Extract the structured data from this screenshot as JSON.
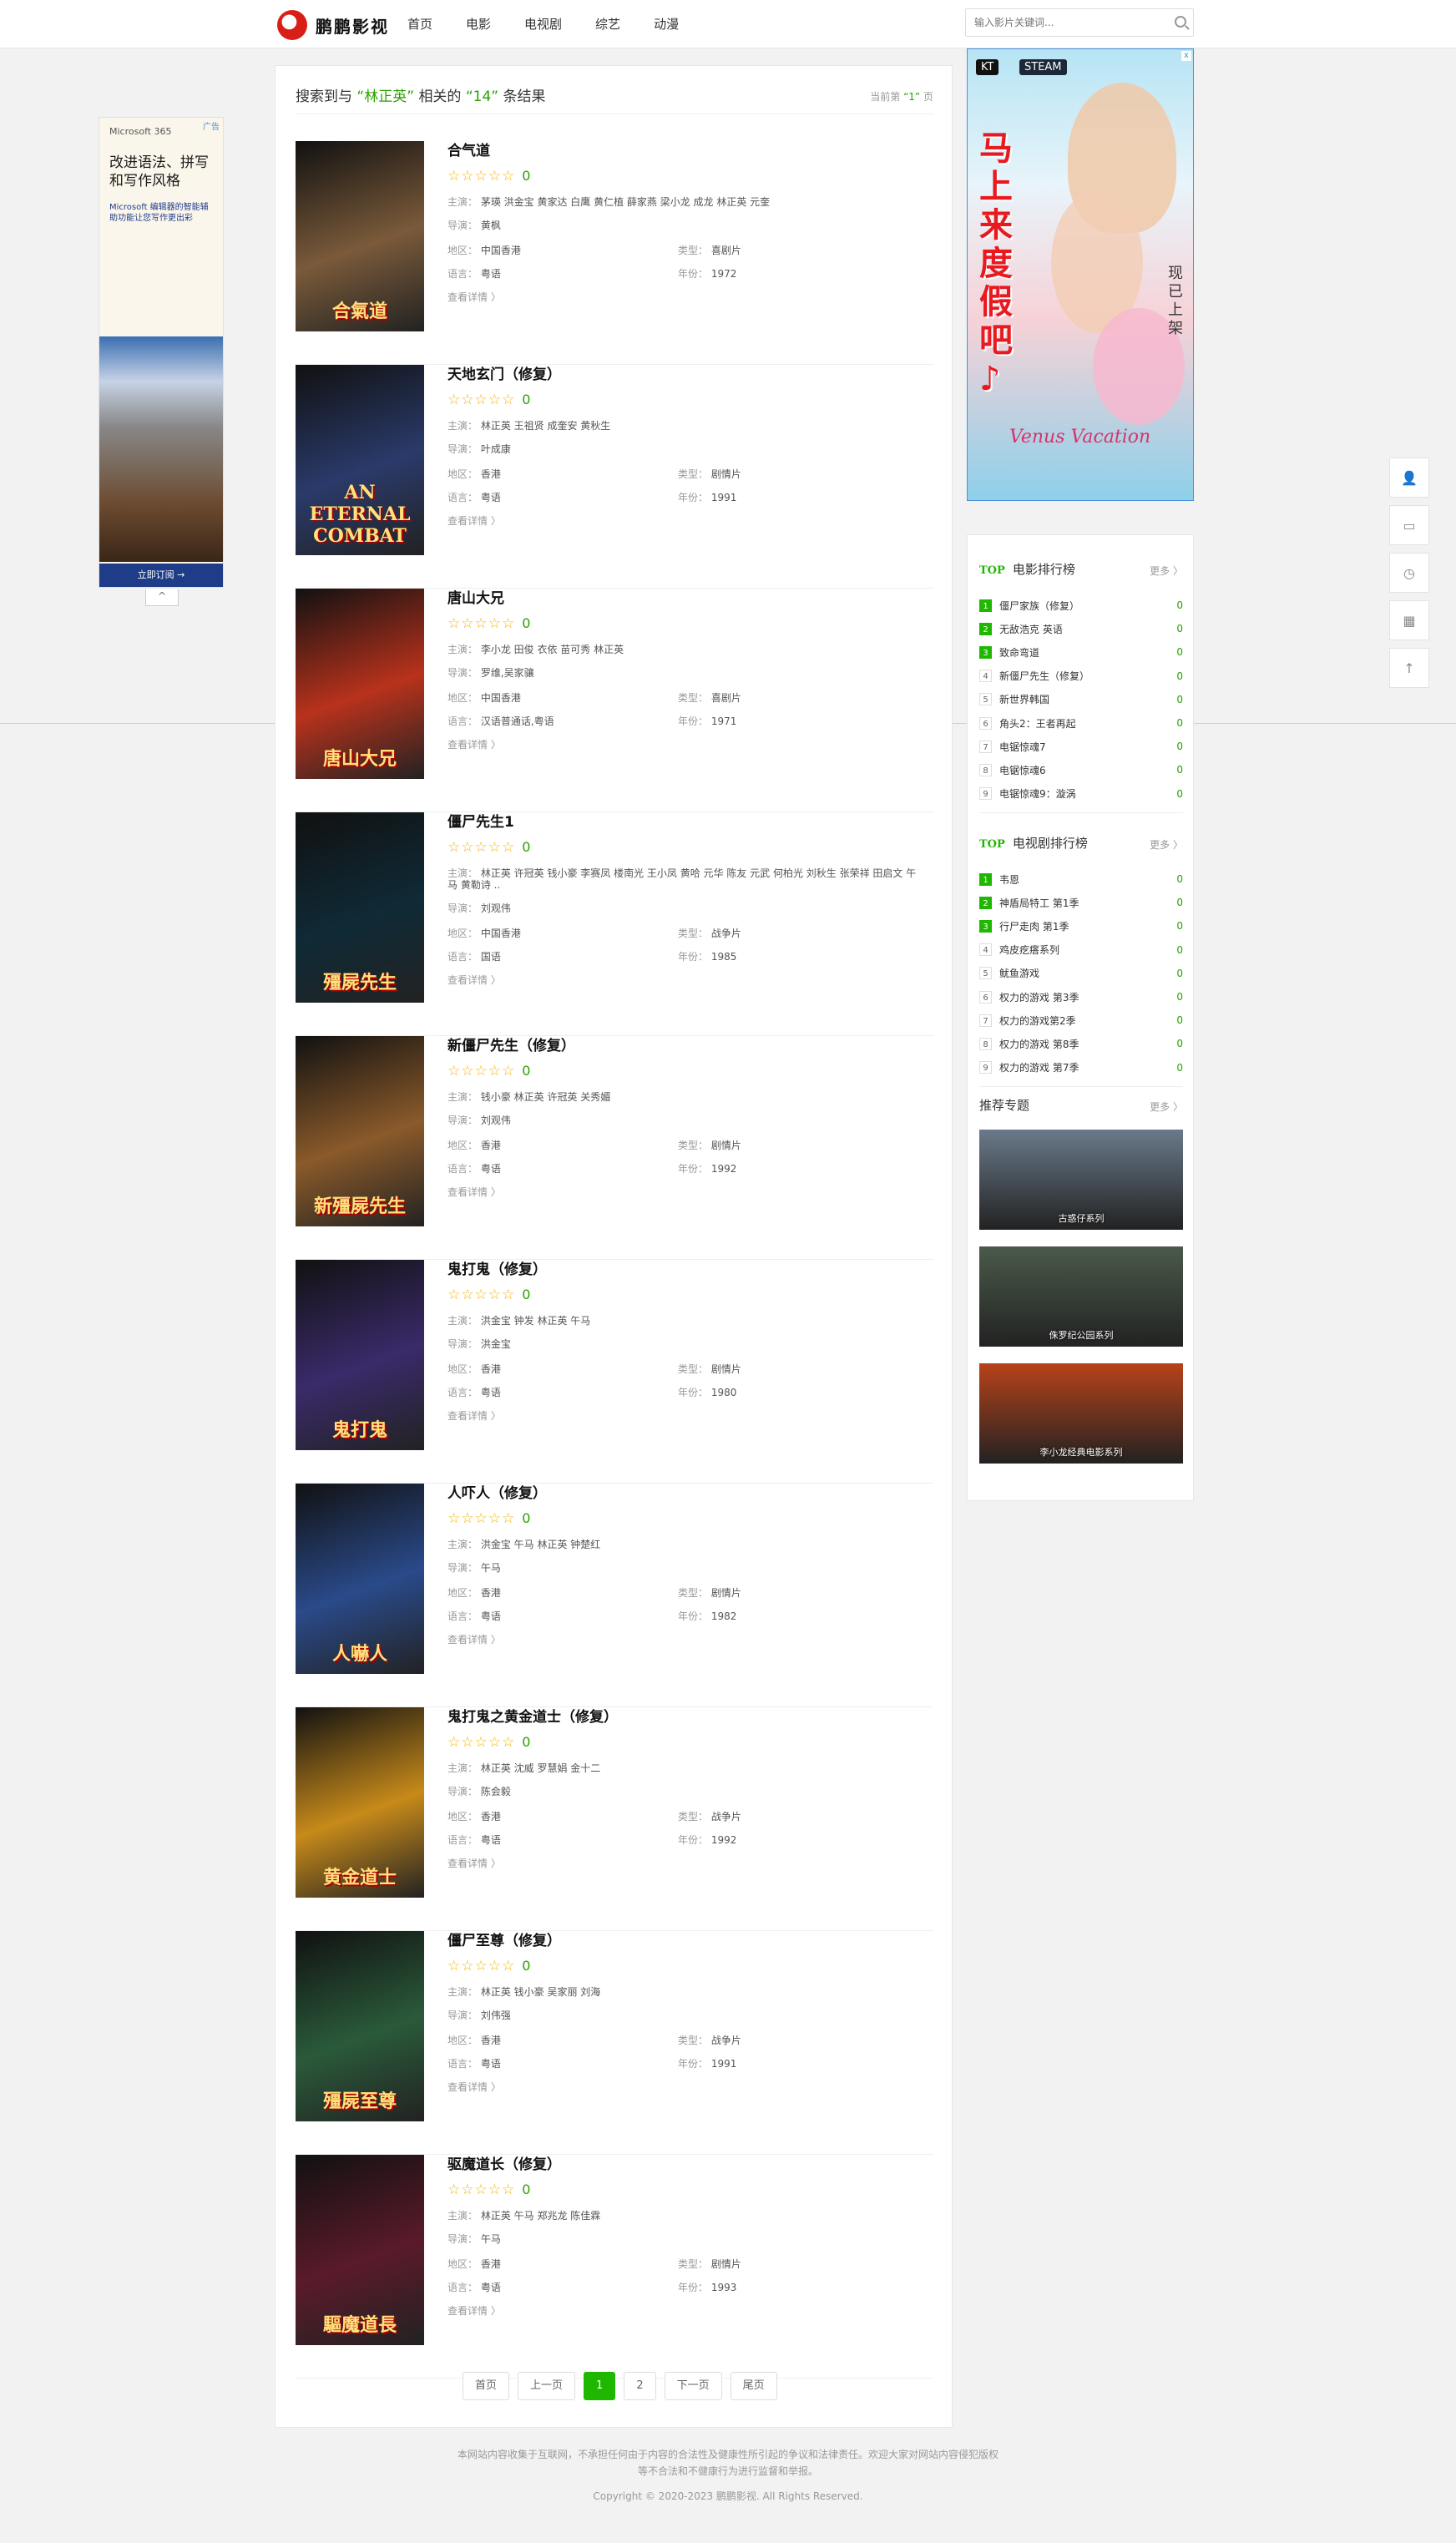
{
  "site": {
    "logo_text": "鹏鹏影视",
    "nav": [
      "首页",
      "电影",
      "电视剧",
      "综艺",
      "动漫"
    ],
    "search_placeholder": "输入影片关键词..."
  },
  "left_ad": {
    "brand": "Microsoft 365",
    "ad_mark": "广告",
    "headline": "改进语法、拼写和写作风格",
    "sub": "Microsoft 编辑器的智能辅助功能让您写作更出彩",
    "cta": "立即订阅 →",
    "close": "^"
  },
  "results": {
    "prefix": "搜索到与",
    "keyword": "“林正英”",
    "middle": "相关的",
    "count": "“14”",
    "suffix": "条结果",
    "page_prefix": "当前第",
    "page_num": "“1”",
    "page_suffix": "页",
    "labels": {
      "actors": "主演：",
      "director": "导演：",
      "region": "地区：",
      "type": "类型：",
      "lang": "语言：",
      "year": "年份：",
      "detail": "查看详情 〉"
    },
    "stars": "☆☆☆☆☆",
    "items": [
      {
        "title": "合气道",
        "score": "0",
        "actors": "茅瑛 洪金宝 黄家达 白鹰 黄仁植 薛家燕 梁小龙 成龙 林正英 元奎",
        "director": "黄枫",
        "region": "中国香港",
        "type": "喜剧片",
        "lang": "粤语",
        "year": "1972",
        "poster_text": "合氣道",
        "poster_color": "#7a5a3a"
      },
      {
        "title": "天地玄门（修复）",
        "score": "0",
        "actors": "林正英 王祖贤 成奎安 黄秋生",
        "director": "叶成康",
        "region": "香港",
        "type": "剧情片",
        "lang": "粤语",
        "year": "1991",
        "poster_text": "AN ETERNAL COMBAT",
        "poster_color": "#2a3a6a"
      },
      {
        "title": "唐山大兄",
        "score": "0",
        "actors": "李小龙 田俊 衣依 苗可秀 林正英",
        "director": "罗维,吴家骧",
        "region": "中国香港",
        "type": "喜剧片",
        "lang": "汉语普通话,粤语",
        "year": "1971",
        "poster_text": "唐山大兄",
        "poster_color": "#b8321c"
      },
      {
        "title": "僵尸先生1",
        "score": "0",
        "actors": "林正英 许冠英 钱小豪 李赛凤 楼南光 王小凤 黄哈 元华 陈友 元武 何柏光 刘秋生 张荣祥 田启文 午马 黄勒诗 ..",
        "director": "刘观伟",
        "region": "中国香港",
        "type": "战争片",
        "lang": "国语",
        "year": "1985",
        "poster_text": "殭屍先生",
        "poster_color": "#0f2a36"
      },
      {
        "title": "新僵尸先生（修复）",
        "score": "0",
        "actors": "钱小豪 林正英 许冠英 关秀媚",
        "director": "刘观伟",
        "region": "香港",
        "type": "剧情片",
        "lang": "粤语",
        "year": "1992",
        "poster_text": "新殭屍先生",
        "poster_color": "#8a5a2a"
      },
      {
        "title": "鬼打鬼（修复）",
        "score": "0",
        "actors": "洪金宝 钟发 林正英 午马",
        "director": "洪金宝",
        "region": "香港",
        "type": "剧情片",
        "lang": "粤语",
        "year": "1980",
        "poster_text": "鬼打鬼",
        "poster_color": "#3a2a6a"
      },
      {
        "title": "人吓人（修复）",
        "score": "0",
        "actors": "洪金宝 午马 林正英 钟楚红",
        "director": "午马",
        "region": "香港",
        "type": "剧情片",
        "lang": "粤语",
        "year": "1982",
        "poster_text": "人嚇人",
        "poster_color": "#2a4a8a"
      },
      {
        "title": "鬼打鬼之黄金道士（修复）",
        "score": "0",
        "actors": "林正英 沈威 罗慧娟 金十二",
        "director": "陈会毅",
        "region": "香港",
        "type": "战争片",
        "lang": "粤语",
        "year": "1992",
        "poster_text": "黄金道士",
        "poster_color": "#c78a1a"
      },
      {
        "title": "僵尸至尊（修复）",
        "score": "0",
        "actors": "林正英 钱小豪 吴家丽 刘海",
        "director": "刘伟强",
        "region": "香港",
        "type": "战争片",
        "lang": "粤语",
        "year": "1991",
        "poster_text": "殭屍至尊",
        "poster_color": "#2a5a3a"
      },
      {
        "title": "驱魔道长（修复）",
        "score": "0",
        "actors": "林正英 午马 郑兆龙 陈佳霖",
        "director": "午马",
        "region": "香港",
        "type": "剧情片",
        "lang": "粤语",
        "year": "1993",
        "poster_text": "驅魔道長",
        "poster_color": "#5a1a2a"
      }
    ]
  },
  "pager": {
    "first": "首页",
    "prev": "上一页",
    "pages": [
      "1",
      "2"
    ],
    "next": "下一页",
    "last": "尾页"
  },
  "right_ad": {
    "brand": "KT",
    "steam": "STEAM",
    "headline": "马上来度假吧♪",
    "side": "现已上架",
    "title": "Venus Vacation",
    "close": "x"
  },
  "movie_rank": {
    "top": "TOP",
    "title": "电影排行榜",
    "more": "更多 〉",
    "items": [
      {
        "n": "1",
        "name": "僵尸家族（修复）",
        "v": "0"
      },
      {
        "n": "2",
        "name": "无敌浩克 英语",
        "v": "0"
      },
      {
        "n": "3",
        "name": "致命弯道",
        "v": "0"
      },
      {
        "n": "4",
        "name": "新僵尸先生（修复）",
        "v": "0"
      },
      {
        "n": "5",
        "name": "新世界韩国",
        "v": "0"
      },
      {
        "n": "6",
        "name": "角头2：王者再起",
        "v": "0"
      },
      {
        "n": "7",
        "name": "电锯惊魂7",
        "v": "0"
      },
      {
        "n": "8",
        "name": "电锯惊魂6",
        "v": "0"
      },
      {
        "n": "9",
        "name": "电锯惊魂9：漩涡",
        "v": "0"
      }
    ]
  },
  "tv_rank": {
    "top": "TOP",
    "title": "电视剧排行榜",
    "more": "更多 〉",
    "items": [
      {
        "n": "1",
        "name": "韦恩",
        "v": "0"
      },
      {
        "n": "2",
        "name": "神盾局特工 第1季",
        "v": "0"
      },
      {
        "n": "3",
        "name": "行尸走肉 第1季",
        "v": "0"
      },
      {
        "n": "4",
        "name": "鸡皮疙瘩系列",
        "v": "0"
      },
      {
        "n": "5",
        "name": "鱿鱼游戏",
        "v": "0"
      },
      {
        "n": "6",
        "name": "权力的游戏 第3季",
        "v": "0"
      },
      {
        "n": "7",
        "name": "权力的游戏第2季",
        "v": "0"
      },
      {
        "n": "8",
        "name": "权力的游戏 第8季",
        "v": "0"
      },
      {
        "n": "9",
        "name": "权力的游戏 第7季",
        "v": "0"
      }
    ]
  },
  "topics": {
    "title": "推荐专题",
    "more": "更多 〉",
    "items": [
      {
        "caption": "古惑仔系列",
        "color": "#6a7a8a"
      },
      {
        "caption": "侏罗纪公园系列",
        "color": "#4a5a4a"
      },
      {
        "caption": "李小龙经典电影系列",
        "color": "#b8421a"
      }
    ]
  },
  "tools": {
    "user": "👤",
    "msg": "▭",
    "history": "◷",
    "qr": "▦",
    "top": "↑"
  },
  "footer": {
    "line1": "本网站内容收集于互联网，不承担任何由于内容的合法性及健康性所引起的争议和法律责任。欢迎大家对网站内容侵犯版权",
    "line2": "等不合法和不健康行为进行监督和举报。",
    "copy": "Copyright © 2020-2023 鹏鹏影视. All Rights Reserved."
  }
}
